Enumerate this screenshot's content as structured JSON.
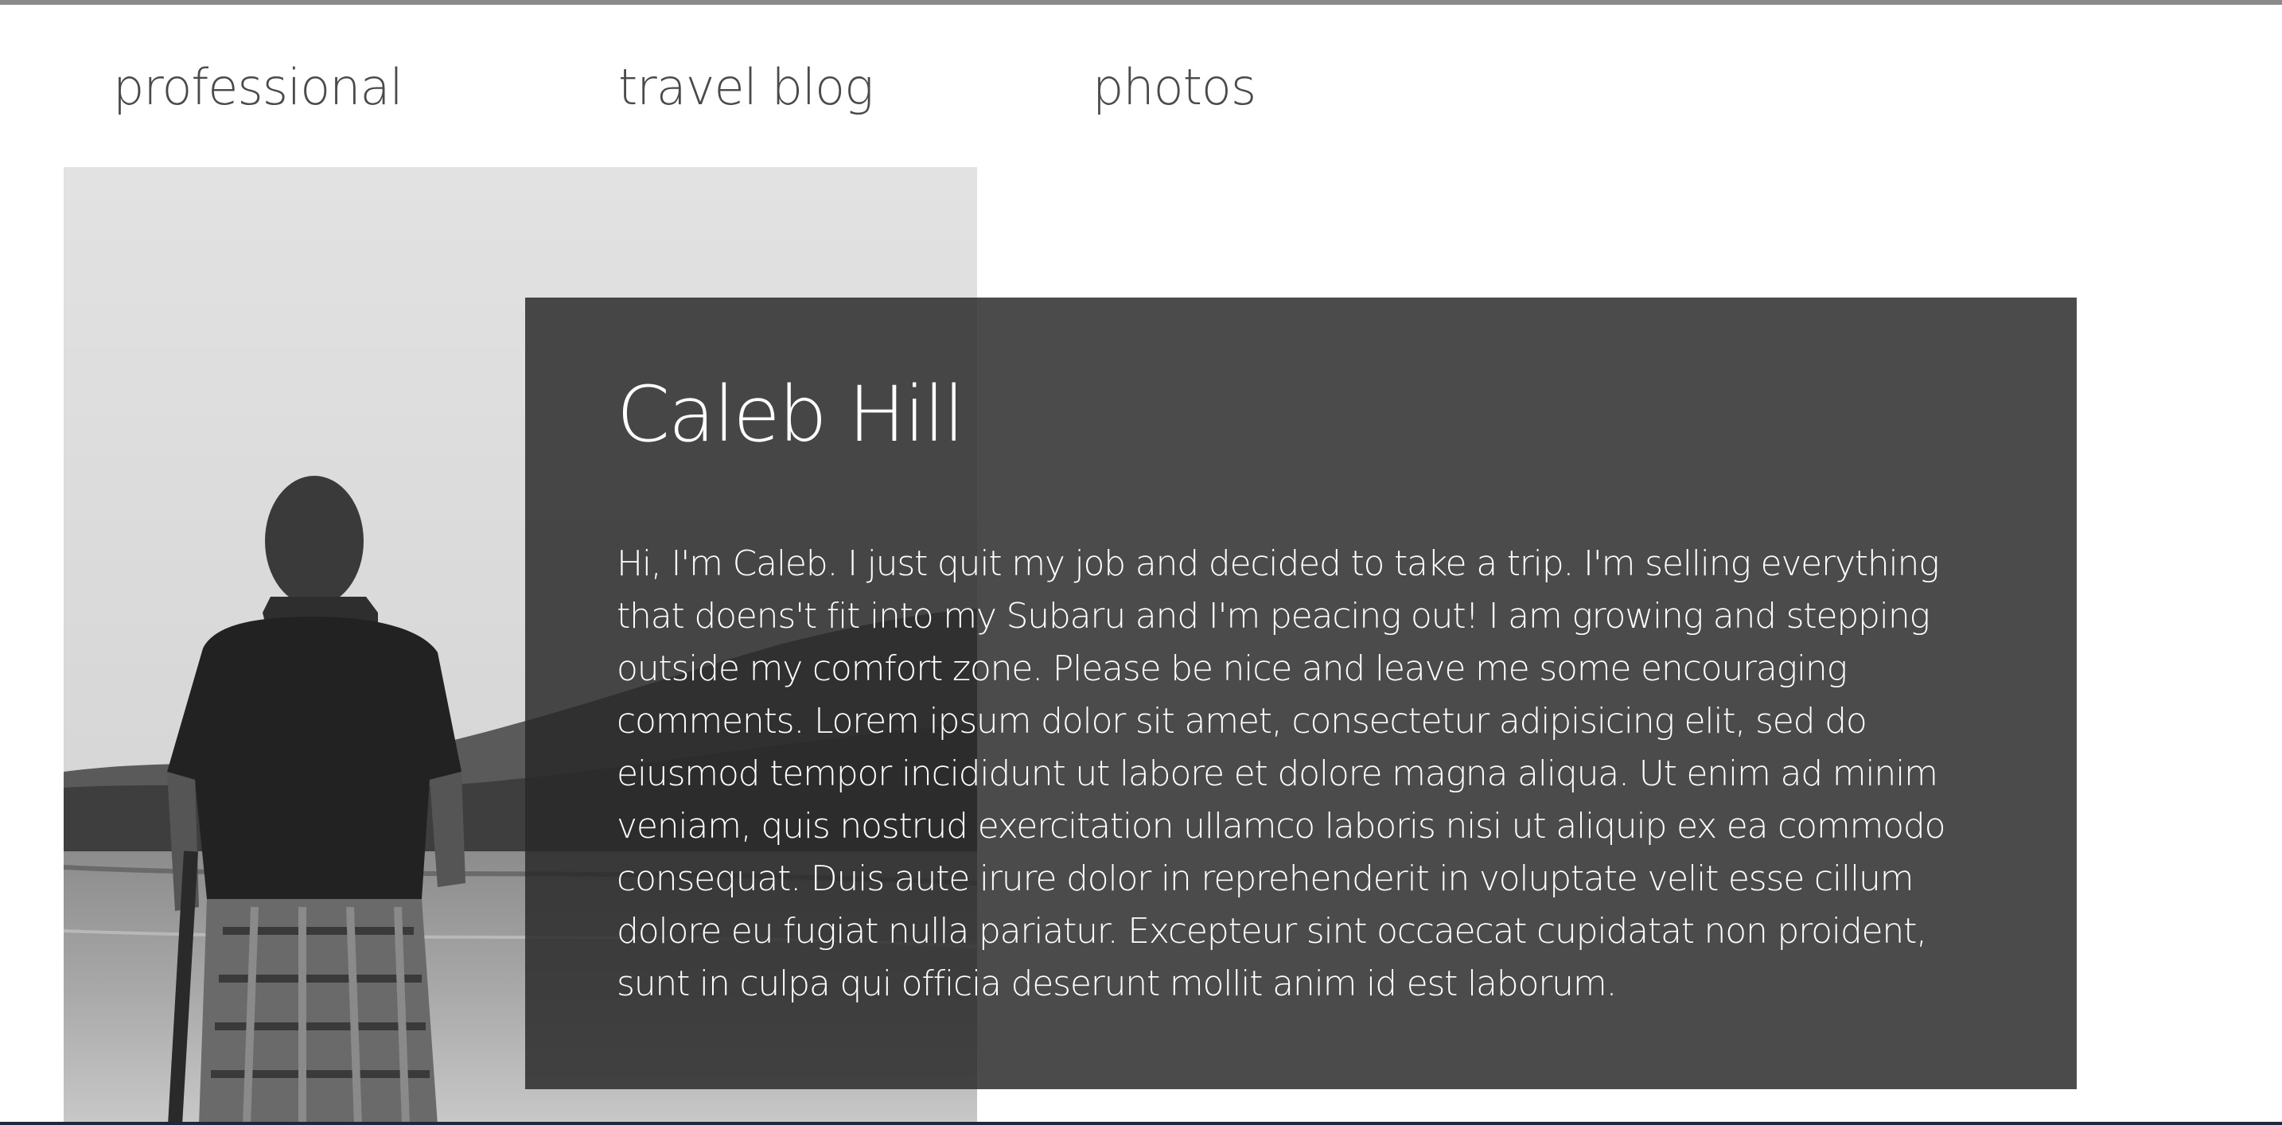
{
  "nav": {
    "items": [
      {
        "label": "professional"
      },
      {
        "label": "travel blog"
      },
      {
        "label": "photos"
      }
    ]
  },
  "hero": {
    "photo_icon": "man-by-lake-photo",
    "title": "Caleb Hill",
    "body": "Hi, I'm Caleb. I just quit my job and decided to take a trip. I'm selling everything that doens't fit into my Subaru and I'm peacing out! I am growing and stepping outside my comfort zone. Please be nice and leave me some encouraging comments. Lorem ipsum dolor sit amet, consectetur adipisicing elit, sed do eiusmod tempor incididunt ut labore et dolore magna aliqua. Ut enim ad minim veniam, quis nostrud exercitation ullamco laboris nisi ut aliquip ex ea commodo consequat. Duis aute irure dolor in reprehenderit in voluptate velit esse cillum dolore eu fugiat nulla pariatur. Excepteur sint occaecat cupidatat non proident, sunt in culpa qui officia deserunt mollit anim id est laborum."
  },
  "colors": {
    "nav_text": "#4a4a4a",
    "card_bg": "#3a3a3a",
    "card_text": "#ffffff",
    "top_rule": "#8a8a8a"
  }
}
